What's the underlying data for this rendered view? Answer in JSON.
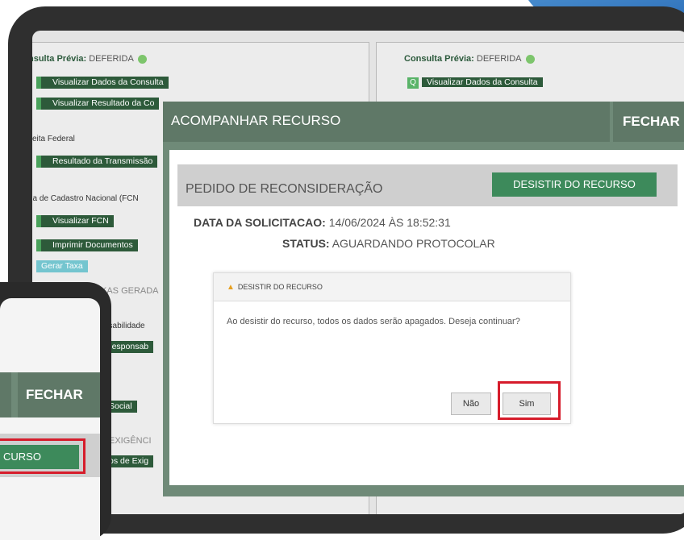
{
  "panels": {
    "left": {
      "prev_label": "nsulta Prévia:",
      "prev_value": "DEFERIDA",
      "btn_view_data": "Visualizar Dados da Consulta",
      "btn_view_result": "Visualizar Resultado da Co",
      "section_receita": "ceita Federal",
      "btn_transmission": "Resultado da Transmissão",
      "section_fcn": "ha de Cadastro Nacional (FCN",
      "btn_view_fcn": "Visualizar FCN",
      "btn_print_docs": "Imprimir Documentos",
      "btn_fee": "Gerar Taxa",
      "section_fees": "KAS GERADA",
      "section_resp": "nsabilidade",
      "btn_resp": "Responsab",
      "btn_social": "Social",
      "section_req": "EXIGÊNCI",
      "btn_req": "os de Exig"
    },
    "right": {
      "prev_label": "Consulta Prévia:",
      "prev_value": "DEFERIDA",
      "btn_view_data": "Visualizar Dados da Consulta",
      "search_icon": "Q"
    }
  },
  "modal": {
    "title": "ACOMPANHAR RECURSO",
    "close_label": "FECHAR",
    "request_title": "PEDIDO DE RECONSIDERAÇÃO",
    "desist_button": "DESISTIR DO RECURSO",
    "date_label": "DATA DA SOLICITACAO:",
    "date_value": "14/06/2024 ÀS 18:52:31",
    "status_label": "STATUS:",
    "status_value": "AGUARDANDO PROTOCOLAR"
  },
  "dialog": {
    "title": "DESISTIR DO RECURSO",
    "warning_icon": "warning-icon",
    "message": "Ao desistir do recurso, todos os dados serão apagados. Deseja continuar?",
    "no_button": "Não",
    "yes_button": "Sim"
  },
  "phone": {
    "close_label": "FECHAR",
    "button_fragment": "CURSO"
  },
  "colors": {
    "green_dark": "#2d5a3a",
    "modal_header": "#5f7867",
    "action_green": "#3d8a5b",
    "highlight_red": "#d61c2b"
  }
}
